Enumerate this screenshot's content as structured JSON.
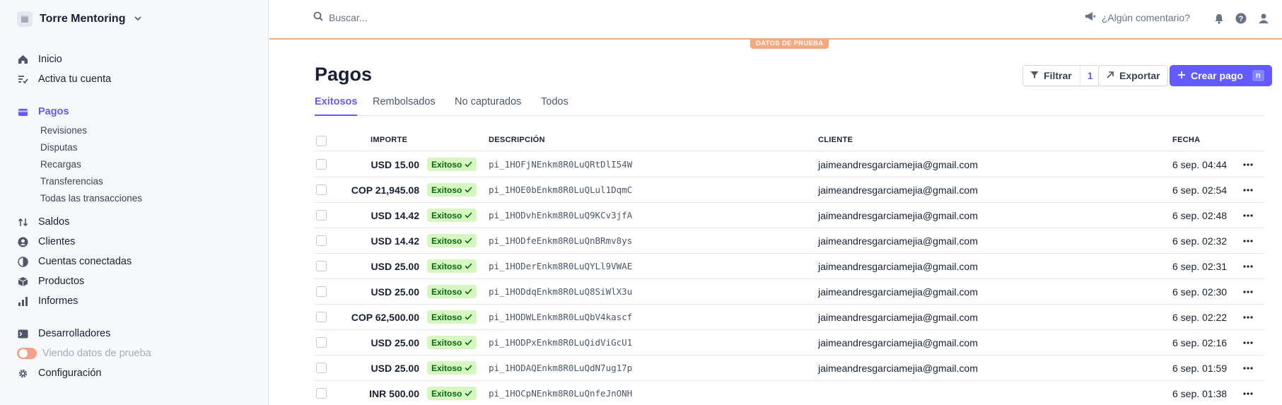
{
  "account": {
    "name": "Torre Mentoring"
  },
  "sidebar": {
    "items": [
      {
        "label": "Inicio",
        "icon": "home-icon"
      },
      {
        "label": "Activa tu cuenta",
        "icon": "checklist-icon"
      },
      {
        "label": "Pagos",
        "icon": "payments-icon",
        "active": true
      },
      {
        "label": "Saldos",
        "icon": "balance-icon"
      },
      {
        "label": "Clientes",
        "icon": "customer-icon"
      },
      {
        "label": "Cuentas conectadas",
        "icon": "globe-icon"
      },
      {
        "label": "Productos",
        "icon": "box-icon"
      },
      {
        "label": "Informes",
        "icon": "chart-icon"
      },
      {
        "label": "Desarrolladores",
        "icon": "terminal-icon"
      },
      {
        "label": "Viendo datos de prueba",
        "icon": "toggle-icon"
      },
      {
        "label": "Configuración",
        "icon": "gear-icon"
      }
    ],
    "subitems": [
      "Revisiones",
      "Disputas",
      "Recargas",
      "Transferencias",
      "Todas las transacciones"
    ]
  },
  "topbar": {
    "search_placeholder": "Buscar...",
    "feedback": "¿Algún comentario?",
    "test_badge": "DATOS DE PRUEBA"
  },
  "page": {
    "title": "Pagos",
    "filter_label": "Filtrar",
    "filter_count": "1",
    "export_label": "Exportar",
    "create_label": "Crear pago",
    "create_shortcut": "n"
  },
  "tabs": [
    "Exitosos",
    "Rembolsados",
    "No capturados",
    "Todos"
  ],
  "table": {
    "headers": {
      "amount": "IMPORTE",
      "description": "DESCRIPCIÓN",
      "customer": "CLIENTE",
      "date": "FECHA"
    },
    "status_label": "Exitoso",
    "rows": [
      {
        "amount": "USD 15.00",
        "description": "pi_1HOFjNEnkm8R0LuQRtDlI54W",
        "customer": "jaimeandresgarciamejia@gmail.com",
        "date": "6 sep. 04:44"
      },
      {
        "amount": "COP 21,945.08",
        "description": "pi_1HOE0bEnkm8R0LuQLul1DqmC",
        "customer": "jaimeandresgarciamejia@gmail.com",
        "date": "6 sep. 02:54"
      },
      {
        "amount": "USD 14.42",
        "description": "pi_1HODvhEnkm8R0LuQ9KCv3jfA",
        "customer": "jaimeandresgarciamejia@gmail.com",
        "date": "6 sep. 02:48"
      },
      {
        "amount": "USD 14.42",
        "description": "pi_1HODfeEnkm8R0LuQnBRmv8ys",
        "customer": "jaimeandresgarciamejia@gmail.com",
        "date": "6 sep. 02:32"
      },
      {
        "amount": "USD 25.00",
        "description": "pi_1HODerEnkm8R0LuQYLl9VWAE",
        "customer": "jaimeandresgarciamejia@gmail.com",
        "date": "6 sep. 02:31"
      },
      {
        "amount": "USD 25.00",
        "description": "pi_1HODdqEnkm8R0LuQ8SiWlX3u",
        "customer": "jaimeandresgarciamejia@gmail.com",
        "date": "6 sep. 02:30"
      },
      {
        "amount": "COP 62,500.00",
        "description": "pi_1HODWLEnkm8R0LuQbV4kascf",
        "customer": "jaimeandresgarciamejia@gmail.com",
        "date": "6 sep. 02:22"
      },
      {
        "amount": "USD 25.00",
        "description": "pi_1HODPxEnkm8R0LuQidViGcU1",
        "customer": "jaimeandresgarciamejia@gmail.com",
        "date": "6 sep. 02:16"
      },
      {
        "amount": "USD 25.00",
        "description": "pi_1HODAQEnkm8R0LuQdN7ug17p",
        "customer": "jaimeandresgarciamejia@gmail.com",
        "date": "6 sep. 01:59"
      },
      {
        "amount": "INR 500.00",
        "description": "pi_1HOCpNEnkm8R0LuQnfeJnONH",
        "customer": "",
        "date": "6 sep. 01:38"
      }
    ]
  },
  "colors": {
    "accent": "#635bff",
    "test_mode": "#f8a87c",
    "success_bg": "#d7f7c2",
    "success_text": "#05690d"
  }
}
